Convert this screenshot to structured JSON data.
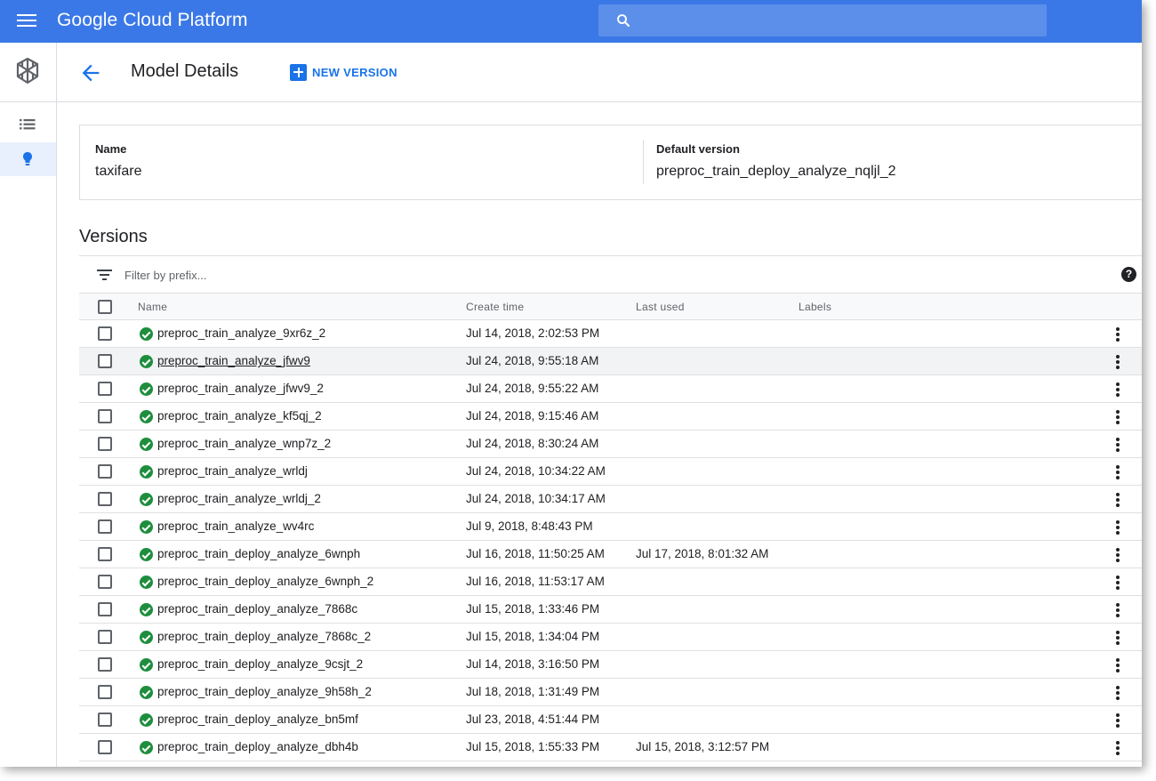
{
  "app": {
    "brand": "Google Cloud Platform"
  },
  "search": {
    "placeholder": ""
  },
  "header": {
    "title": "Model Details",
    "new_version": "NEW VERSION"
  },
  "details": {
    "name_label": "Name",
    "name_value": "taxifare",
    "default_label": "Default version",
    "default_value": "preproc_train_deploy_analyze_nqljl_2"
  },
  "versions": {
    "title": "Versions",
    "filter_placeholder": "Filter by prefix...",
    "columns": {
      "name": "Name",
      "create_time": "Create time",
      "last_used": "Last used",
      "labels": "Labels"
    },
    "rows": [
      {
        "name": "preproc_train_analyze_9xr6z_2",
        "create_time": "Jul 14, 2018, 2:02:53 PM",
        "last_used": ""
      },
      {
        "name": "preproc_train_analyze_jfwv9",
        "create_time": "Jul 24, 2018, 9:55:18 AM",
        "last_used": ""
      },
      {
        "name": "preproc_train_analyze_jfwv9_2",
        "create_time": "Jul 24, 2018, 9:55:22 AM",
        "last_used": ""
      },
      {
        "name": "preproc_train_analyze_kf5qj_2",
        "create_time": "Jul 24, 2018, 9:15:46 AM",
        "last_used": ""
      },
      {
        "name": "preproc_train_analyze_wnp7z_2",
        "create_time": "Jul 24, 2018, 8:30:24 AM",
        "last_used": ""
      },
      {
        "name": "preproc_train_analyze_wrldj",
        "create_time": "Jul 24, 2018, 10:34:22 AM",
        "last_used": ""
      },
      {
        "name": "preproc_train_analyze_wrldj_2",
        "create_time": "Jul 24, 2018, 10:34:17 AM",
        "last_used": ""
      },
      {
        "name": "preproc_train_analyze_wv4rc",
        "create_time": "Jul 9, 2018, 8:48:43 PM",
        "last_used": ""
      },
      {
        "name": "preproc_train_deploy_analyze_6wnph",
        "create_time": "Jul 16, 2018, 11:50:25 AM",
        "last_used": "Jul 17, 2018, 8:01:32 AM"
      },
      {
        "name": "preproc_train_deploy_analyze_6wnph_2",
        "create_time": "Jul 16, 2018, 11:53:17 AM",
        "last_used": ""
      },
      {
        "name": "preproc_train_deploy_analyze_7868c",
        "create_time": "Jul 15, 2018, 1:33:46 PM",
        "last_used": ""
      },
      {
        "name": "preproc_train_deploy_analyze_7868c_2",
        "create_time": "Jul 15, 2018, 1:34:04 PM",
        "last_used": ""
      },
      {
        "name": "preproc_train_deploy_analyze_9csjt_2",
        "create_time": "Jul 14, 2018, 3:16:50 PM",
        "last_used": ""
      },
      {
        "name": "preproc_train_deploy_analyze_9h58h_2",
        "create_time": "Jul 18, 2018, 1:31:49 PM",
        "last_used": ""
      },
      {
        "name": "preproc_train_deploy_analyze_bn5mf",
        "create_time": "Jul 23, 2018, 4:51:44 PM",
        "last_used": ""
      },
      {
        "name": "preproc_train_deploy_analyze_dbh4b",
        "create_time": "Jul 15, 2018, 1:55:33 PM",
        "last_used": "Jul 15, 2018, 3:12:57 PM"
      }
    ]
  },
  "colors": {
    "topbar": "#3b78e7",
    "accent": "#1a73e8",
    "status_ok": "#1e8e3e"
  }
}
